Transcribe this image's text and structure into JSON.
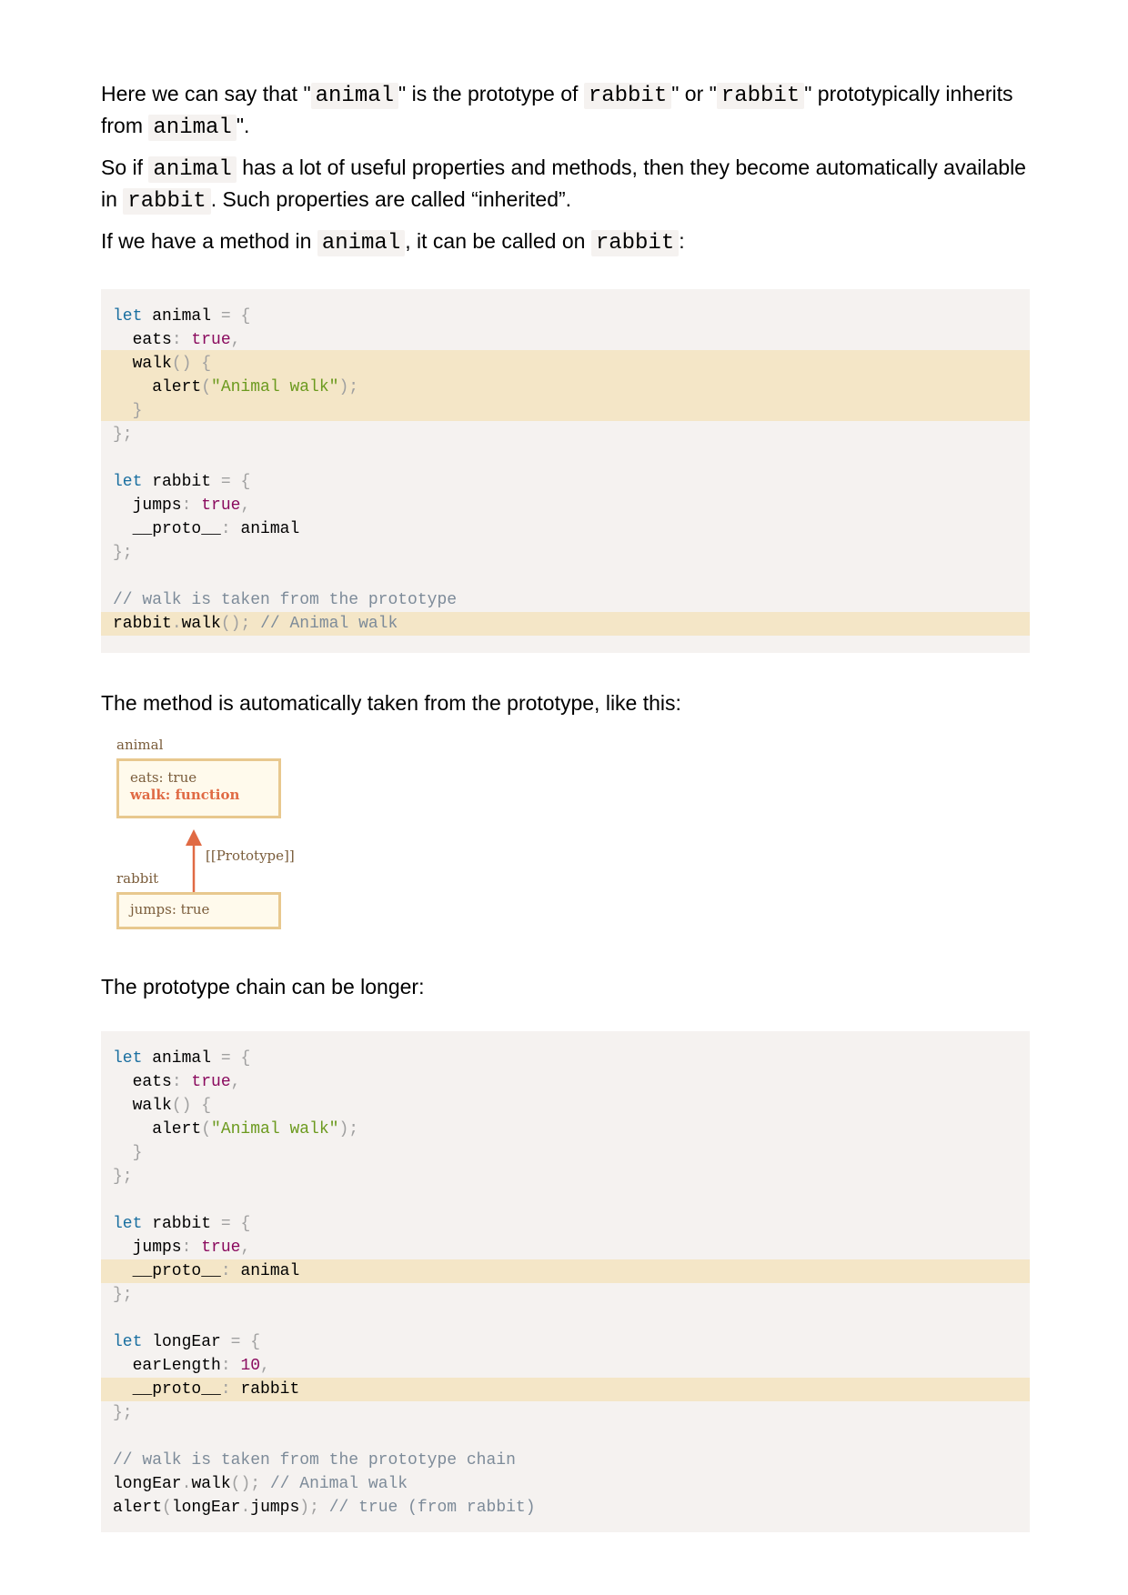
{
  "intro": {
    "p1": {
      "t1": "Here we can say that \"",
      "c1": "animal",
      "t2": "\" is the prototype of ",
      "c2": "rabbit",
      "t3": "\" or \"",
      "c3": "rabbit",
      "t4": "\" prototypically inherits from ",
      "c4": "animal",
      "t5": "\"."
    },
    "p2": {
      "t1": "So if ",
      "c1": "animal",
      "t2": " has a lot of useful properties and methods, then they become automatically available in ",
      "c2": "rabbit",
      "t3": ". Such properties are called “inherited”."
    },
    "p3": {
      "t1": "If we have a method in ",
      "c1": "animal",
      "t2": ", it can be called on ",
      "c2": "rabbit",
      "t3": ":"
    }
  },
  "middle_text": "The method is automatically taken from the prototype, like this:",
  "chain_text": "The prototype chain can be longer:",
  "diagram": {
    "top_label": "animal",
    "top_line1": "eats: true",
    "top_line2": "walk: function",
    "arrow_label": "[[Prototype]]",
    "bottom_label": "rabbit",
    "bottom_line1": "jumps: true",
    "arrow_color": "#e06a44",
    "box_border_color": "#e8c88e"
  },
  "code1": {
    "l1": {
      "kw": "let",
      "id": " animal ",
      "op": "=",
      "br": " {"
    },
    "l2": {
      "id": "  eats",
      "p": ": ",
      "v": "true",
      "c": ","
    },
    "l3": {
      "id": "  walk",
      "p": "() {"
    },
    "l4": {
      "id": "    alert",
      "p1": "(",
      "s": "\"Animal walk\"",
      "p2": ");"
    },
    "l5": {
      "p": "  }"
    },
    "l6": {
      "p": "};"
    },
    "l8": {
      "kw": "let",
      "id": " rabbit ",
      "op": "=",
      "br": " {"
    },
    "l9": {
      "id": "  jumps",
      "p": ": ",
      "v": "true",
      "c": ","
    },
    "l10": {
      "id": "  __proto__",
      "p": ": ",
      "v": "animal"
    },
    "l11": {
      "p": "};"
    },
    "l13": {
      "cm": "// walk is taken from the prototype"
    },
    "l14": {
      "a": "rabbit",
      "d": ".",
      "b": "walk",
      "p": "(); ",
      "cm": "// Animal walk"
    }
  },
  "code2": {
    "l1": {
      "kw": "let",
      "id": " animal ",
      "op": "=",
      "br": " {"
    },
    "l2": {
      "id": "  eats",
      "p": ": ",
      "v": "true",
      "c": ","
    },
    "l3": {
      "id": "  walk",
      "p": "() {"
    },
    "l4": {
      "id": "    alert",
      "p1": "(",
      "s": "\"Animal walk\"",
      "p2": ");"
    },
    "l5": {
      "p": "  }"
    },
    "l6": {
      "p": "};"
    },
    "l8": {
      "kw": "let",
      "id": " rabbit ",
      "op": "=",
      "br": " {"
    },
    "l9": {
      "id": "  jumps",
      "p": ": ",
      "v": "true",
      "c": ","
    },
    "l10": {
      "id": "  __proto__",
      "p": ": ",
      "v": "animal"
    },
    "l11": {
      "p": "};"
    },
    "l13": {
      "kw": "let",
      "id": " longEar ",
      "op": "=",
      "br": " {"
    },
    "l14": {
      "id": "  earLength",
      "p": ": ",
      "v": "10",
      "c": ","
    },
    "l15": {
      "id": "  __proto__",
      "p": ": ",
      "v": "rabbit"
    },
    "l16": {
      "p": "};"
    },
    "l18": {
      "cm": "// walk is taken from the prototype chain"
    },
    "l19": {
      "a": "longEar",
      "d": ".",
      "b": "walk",
      "p": "(); ",
      "cm": "// Animal walk"
    },
    "l20": {
      "a": "alert",
      "p1": "(",
      "b": "longEar",
      "d": ".",
      "c": "jumps",
      "p2": "); ",
      "cm": "// true (from rabbit)"
    }
  }
}
